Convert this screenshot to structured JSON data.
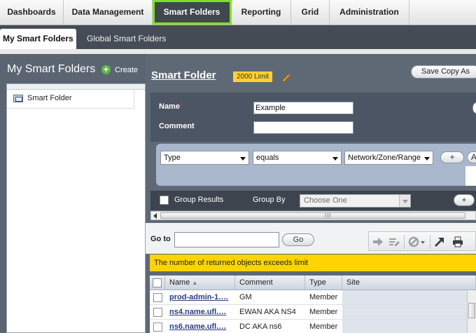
{
  "nav": {
    "tabs": [
      {
        "label": "Dashboards"
      },
      {
        "label": "Data Management"
      },
      {
        "label": "Smart Folders"
      },
      {
        "label": "Reporting"
      },
      {
        "label": "Grid"
      },
      {
        "label": "Administration"
      }
    ],
    "active_tab": "Smart Folders"
  },
  "subnav": {
    "tabs": [
      {
        "label": "My Smart Folders"
      },
      {
        "label": "Global Smart Folders"
      }
    ],
    "active_tab": "My Smart Folders"
  },
  "left_panel": {
    "title": "My Smart Folders",
    "create_label": "Create",
    "tree": [
      {
        "label": "Smart Folder"
      }
    ]
  },
  "editor": {
    "title": "Smart Folder",
    "limit_badge": "2000 Limit",
    "save_copy_label": "Save Copy As",
    "name_label": "Name",
    "required_mark": "*",
    "name_value": "Example",
    "comment_label": "Comment",
    "comment_value": "",
    "filter": {
      "field": "Type",
      "operator": "equals",
      "value": "Network/Zone/Range",
      "add_label": "+",
      "and_label": "A"
    },
    "group_results_label": "Group Results",
    "group_by_label": "Group By",
    "group_by_value": "Choose One",
    "group_add_label": "+",
    "scroll_grip": "III"
  },
  "goto": {
    "label": "Go to",
    "value": "",
    "button_label": "Go"
  },
  "warning": "The number of returned objects exceeds limit",
  "grid": {
    "columns": [
      "Name",
      "Comment",
      "Type",
      "Site"
    ],
    "sort_indicator": "▲",
    "rows": [
      {
        "name": "prod-admin-1.…",
        "comment": "GM",
        "type": "Member",
        "site": ""
      },
      {
        "name": "ns4.name.ufl.…",
        "comment": "EWAN AKA NS4",
        "type": "Member",
        "site": ""
      },
      {
        "name": "ns6.name.ufl.…",
        "comment": "DC AKA ns6",
        "type": "Member",
        "site": ""
      }
    ]
  },
  "colors": {
    "active_tab_outline": "#7be21f",
    "limit_badge": "#ffd22e",
    "warning": "#ffd400",
    "link": "#2a3c82"
  }
}
